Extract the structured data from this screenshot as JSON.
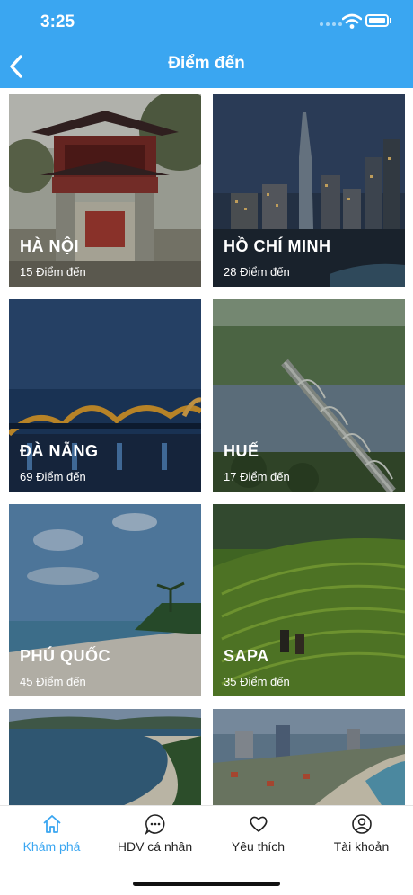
{
  "status": {
    "time": "3:25"
  },
  "header": {
    "title": "Điểm đến"
  },
  "destinations": [
    {
      "name": "HÀ NỘI",
      "count": "15 Điểm đến"
    },
    {
      "name": "HỒ CHÍ MINH",
      "count": "28 Điểm đến"
    },
    {
      "name": "ĐÀ NẴNG",
      "count": "69 Điểm đến"
    },
    {
      "name": "HUẾ",
      "count": "17 Điểm đến"
    },
    {
      "name": "PHÚ QUỐC",
      "count": "45 Điểm đến"
    },
    {
      "name": "SAPA",
      "count": "35 Điểm đến"
    }
  ],
  "tabs": [
    {
      "label": "Khám phá",
      "icon": "home-icon",
      "active": true
    },
    {
      "label": "HDV cá nhân",
      "icon": "chat-icon",
      "active": false
    },
    {
      "label": "Yêu thích",
      "icon": "heart-icon",
      "active": false
    },
    {
      "label": "Tài khoản",
      "icon": "account-icon",
      "active": false
    }
  ],
  "colors": {
    "accent": "#3aa6f1"
  }
}
